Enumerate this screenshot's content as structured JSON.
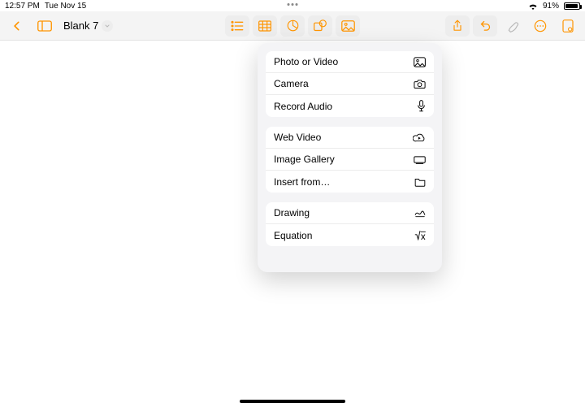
{
  "status": {
    "time": "12:57 PM",
    "date": "Tue Nov 15",
    "battery_pct": "91%"
  },
  "toolbar": {
    "doc_title": "Blank 7"
  },
  "popover": {
    "sect1": {
      "r1": "Photo or Video",
      "r2": "Camera",
      "r3": "Record Audio"
    },
    "sect2": {
      "r1": "Web Video",
      "r2": "Image Gallery",
      "r3": "Insert from…"
    },
    "sect3": {
      "r1": "Drawing",
      "r2": "Equation"
    }
  }
}
